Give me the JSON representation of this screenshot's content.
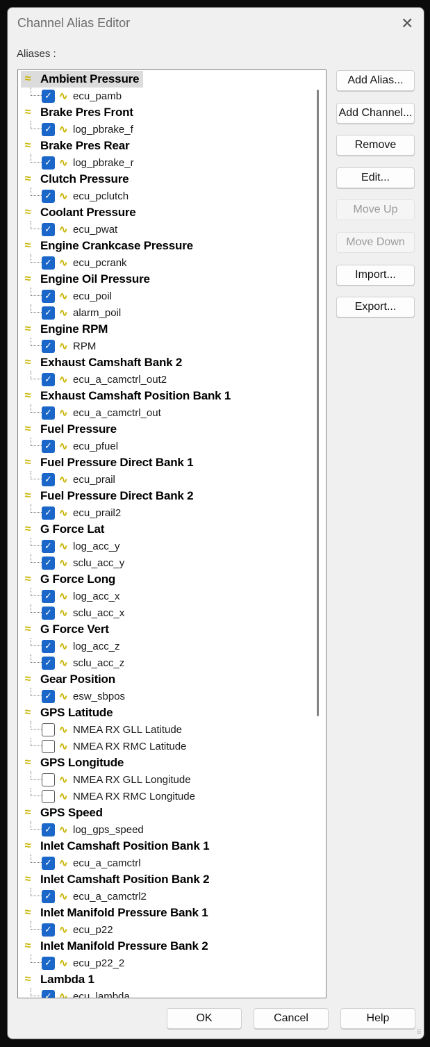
{
  "window": {
    "title": "Channel Alias Editor",
    "close_icon": "close-icon"
  },
  "aliases_label": "Aliases :",
  "aliases": [
    {
      "name": "Ambient Pressure",
      "selected": true,
      "channels": [
        {
          "name": "ecu_pamb",
          "checked": true
        }
      ]
    },
    {
      "name": "Brake Pres Front",
      "channels": [
        {
          "name": "log_pbrake_f",
          "checked": true
        }
      ]
    },
    {
      "name": "Brake Pres Rear",
      "channels": [
        {
          "name": "log_pbrake_r",
          "checked": true
        }
      ]
    },
    {
      "name": "Clutch Pressure",
      "channels": [
        {
          "name": "ecu_pclutch",
          "checked": true
        }
      ]
    },
    {
      "name": "Coolant Pressure",
      "channels": [
        {
          "name": "ecu_pwat",
          "checked": true
        }
      ]
    },
    {
      "name": "Engine Crankcase Pressure",
      "channels": [
        {
          "name": "ecu_pcrank",
          "checked": true
        }
      ]
    },
    {
      "name": "Engine Oil Pressure",
      "channels": [
        {
          "name": "ecu_poil",
          "checked": true
        },
        {
          "name": "alarm_poil",
          "checked": true
        }
      ]
    },
    {
      "name": "Engine RPM",
      "channels": [
        {
          "name": "RPM",
          "checked": true
        }
      ]
    },
    {
      "name": "Exhaust Camshaft Bank 2",
      "channels": [
        {
          "name": "ecu_a_camctrl_out2",
          "checked": true
        }
      ]
    },
    {
      "name": "Exhaust Camshaft Position Bank 1",
      "channels": [
        {
          "name": "ecu_a_camctrl_out",
          "checked": true
        }
      ]
    },
    {
      "name": "Fuel Pressure",
      "channels": [
        {
          "name": "ecu_pfuel",
          "checked": true
        }
      ]
    },
    {
      "name": "Fuel Pressure Direct Bank 1",
      "channels": [
        {
          "name": "ecu_prail",
          "checked": true
        }
      ]
    },
    {
      "name": "Fuel Pressure Direct Bank 2",
      "channels": [
        {
          "name": "ecu_prail2",
          "checked": true
        }
      ]
    },
    {
      "name": "G Force Lat",
      "channels": [
        {
          "name": "log_acc_y",
          "checked": true
        },
        {
          "name": "sclu_acc_y",
          "checked": true
        }
      ]
    },
    {
      "name": "G Force Long",
      "channels": [
        {
          "name": "log_acc_x",
          "checked": true
        },
        {
          "name": "sclu_acc_x",
          "checked": true
        }
      ]
    },
    {
      "name": "G Force Vert",
      "channels": [
        {
          "name": "log_acc_z",
          "checked": true
        },
        {
          "name": "sclu_acc_z",
          "checked": true
        }
      ]
    },
    {
      "name": "Gear Position",
      "channels": [
        {
          "name": "esw_sbpos",
          "checked": true
        }
      ]
    },
    {
      "name": "GPS Latitude",
      "channels": [
        {
          "name": "NMEA RX GLL Latitude",
          "checked": false
        },
        {
          "name": "NMEA RX RMC Latitude",
          "checked": false
        }
      ]
    },
    {
      "name": "GPS Longitude",
      "channels": [
        {
          "name": "NMEA RX GLL Longitude",
          "checked": false
        },
        {
          "name": "NMEA RX RMC Longitude",
          "checked": false
        }
      ]
    },
    {
      "name": "GPS Speed",
      "channels": [
        {
          "name": "log_gps_speed",
          "checked": true
        }
      ]
    },
    {
      "name": "Inlet Camshaft Position Bank 1",
      "channels": [
        {
          "name": "ecu_a_camctrl",
          "checked": true
        }
      ]
    },
    {
      "name": "Inlet Camshaft Position Bank 2",
      "channels": [
        {
          "name": "ecu_a_camctrl2",
          "checked": true
        }
      ]
    },
    {
      "name": "Inlet Manifold Pressure Bank 1",
      "channels": [
        {
          "name": "ecu_p22",
          "checked": true
        }
      ]
    },
    {
      "name": "Inlet Manifold Pressure Bank 2",
      "channels": [
        {
          "name": "ecu_p22_2",
          "checked": true
        }
      ]
    },
    {
      "name": "Lambda 1",
      "channels": [
        {
          "name": "ecu_lambda",
          "checked": true
        }
      ]
    }
  ],
  "side_buttons": [
    {
      "label": "Add Alias...",
      "enabled": true
    },
    {
      "label": "Add Channel...",
      "enabled": true
    },
    {
      "label": "Remove",
      "enabled": true
    },
    {
      "label": "Edit...",
      "enabled": true
    },
    {
      "label": "Move Up",
      "enabled": false
    },
    {
      "label": "Move Down",
      "enabled": false
    },
    {
      "label": "Import...",
      "enabled": true
    },
    {
      "label": "Export...",
      "enabled": true
    }
  ],
  "footer": {
    "ok": "OK",
    "cancel": "Cancel",
    "help": "Help"
  },
  "colors": {
    "accent": "#1a66c9",
    "alias_icon": "#c8b400"
  }
}
